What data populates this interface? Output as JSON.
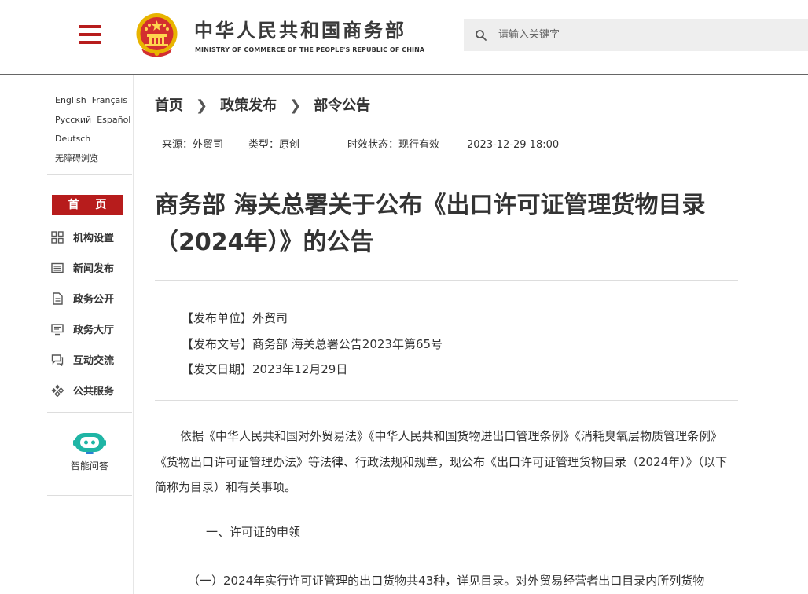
{
  "header": {
    "site_title": "中华人民共和国商务部",
    "site_subtitle": "MINISTRY OF COMMERCE OF THE PEOPLE'S REPUBLIC OF CHINA",
    "emblem_icon": "national-emblem-icon",
    "menu_icon": "hamburger-menu-icon",
    "search": {
      "placeholder": "请输入关键字",
      "value": ""
    }
  },
  "sidebar": {
    "languages": [
      [
        "English",
        "Français"
      ],
      [
        "Русский",
        "Español"
      ],
      [
        "Deutsch"
      ],
      [
        "无障碍浏览"
      ]
    ],
    "home_label": "首 页",
    "nav_items": [
      {
        "label": "机构设置",
        "icon": "org-grid-icon"
      },
      {
        "label": "新闻发布",
        "icon": "newspaper-icon"
      },
      {
        "label": "政务公开",
        "icon": "document-icon"
      },
      {
        "label": "政务大厅",
        "icon": "monitor-icon"
      },
      {
        "label": "互动交流",
        "icon": "chat-icon"
      },
      {
        "label": "公共服务",
        "icon": "service-diamond-icon"
      }
    ],
    "qa_label": "智能问答",
    "qa_icon": "robot-chat-icon"
  },
  "breadcrumb": [
    "首页",
    "政策发布",
    "部令公告"
  ],
  "meta": {
    "source": "来源：外贸司",
    "type": "类型：原创",
    "status": "时效状态：现行有效",
    "datetime": "2023-12-29 18:00"
  },
  "article": {
    "title": "商务部 海关总署关于公布《出口许可证管理货物目录（2024年）》的公告",
    "issuer": "【发布单位】外贸司",
    "doc_number": "【发布文号】商务部 海关总署公告2023年第65号",
    "issue_date": "【发文日期】2023年12月29日",
    "paragraph1": "依据《中华人民共和国对外贸易法》《中华人民共和国货物进出口管理条例》《消耗臭氧层物质管理条例》《货物出口许可证管理办法》等法律、行政法规和规章，现公布《出口许可证管理货物目录（2024年）》（以下简称为目录）和有关事项。",
    "section1": "一、许可证的申领",
    "paragraph2": "（一）2024年实行许可证管理的出口货物共43种，详见目录。对外贸易经营者出口目录内所列货物"
  },
  "colors": {
    "brand_red": "#b71c1c",
    "qa_teal": "#1fb5a5"
  }
}
